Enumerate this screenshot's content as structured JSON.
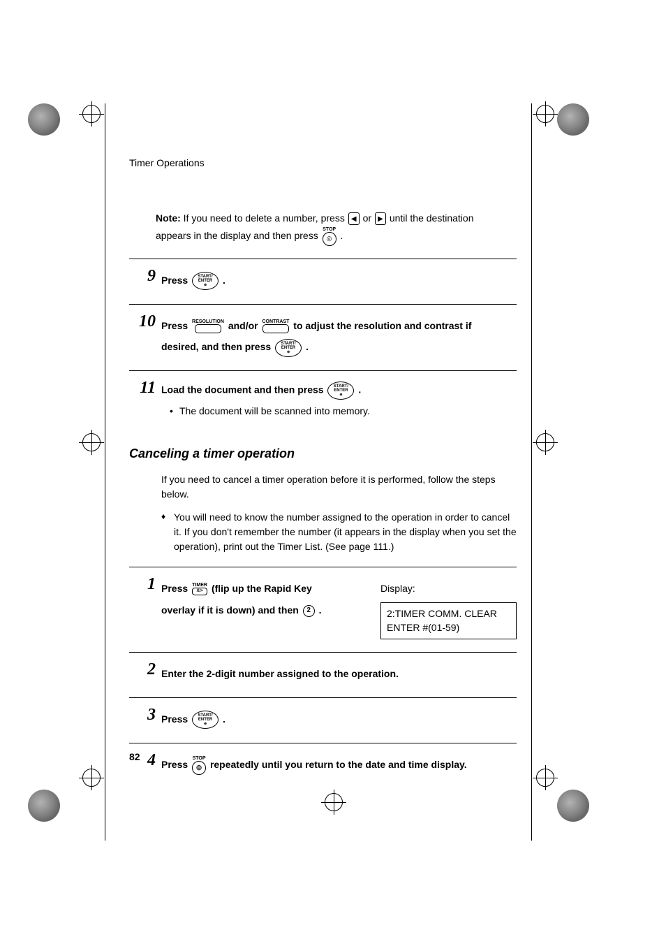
{
  "running_head": "Timer Operations",
  "note": {
    "prefix": "Note:",
    "text1": " If you need to delete a number, press ",
    "or": " or ",
    "text2": " until the destination",
    "line2a": "appears in the display and then press ",
    "line2b": " ."
  },
  "buttons": {
    "start_enter": "START/\nENTER",
    "stop": "STOP",
    "timer": "TIMER",
    "timer_sub": "X/>",
    "resolution": "RESOLUTION",
    "contrast": "CONTRAST"
  },
  "steps_a": {
    "s9": {
      "num": "9",
      "press": "Press ",
      "dot": "."
    },
    "s10": {
      "num": "10",
      "press": "Press ",
      "andor": " and/or ",
      "tail": " to adjust the resolution and contrast if",
      "line2a": "desired, and then press ",
      "line2b": "."
    },
    "s11": {
      "num": "11",
      "text": "Load the document and then press ",
      "dot": " .",
      "bullet": "The document will be scanned into memory."
    }
  },
  "cancel": {
    "heading": "Canceling a timer operation",
    "intro": "If you need to cancel a timer operation before it is performed, follow the steps below.",
    "diamond": "You will need to know the number assigned to the operation in order to cancel it. If you don't remember the number (it appears in the display when you set the operation), print out the Timer List. (See page 111.)"
  },
  "steps_b": {
    "s1": {
      "num": "1",
      "press": "Press ",
      "flip": " (flip up the Rapid Key",
      "line2a": "overlay if it is down) and then ",
      "line2b": ".",
      "display_label": "Display:",
      "display_line1": "2:TIMER COMM. CLEAR",
      "display_line2": "ENTER #(01-59)"
    },
    "s2": {
      "num": "2",
      "text": "Enter the 2-digit number assigned to the operation."
    },
    "s3": {
      "num": "3",
      "press": "Press ",
      "dot": "."
    },
    "s4": {
      "num": "4",
      "press": "Press ",
      "tail": " repeatedly until you return to the date and time display."
    }
  },
  "page_num": "82",
  "circle2": "2"
}
